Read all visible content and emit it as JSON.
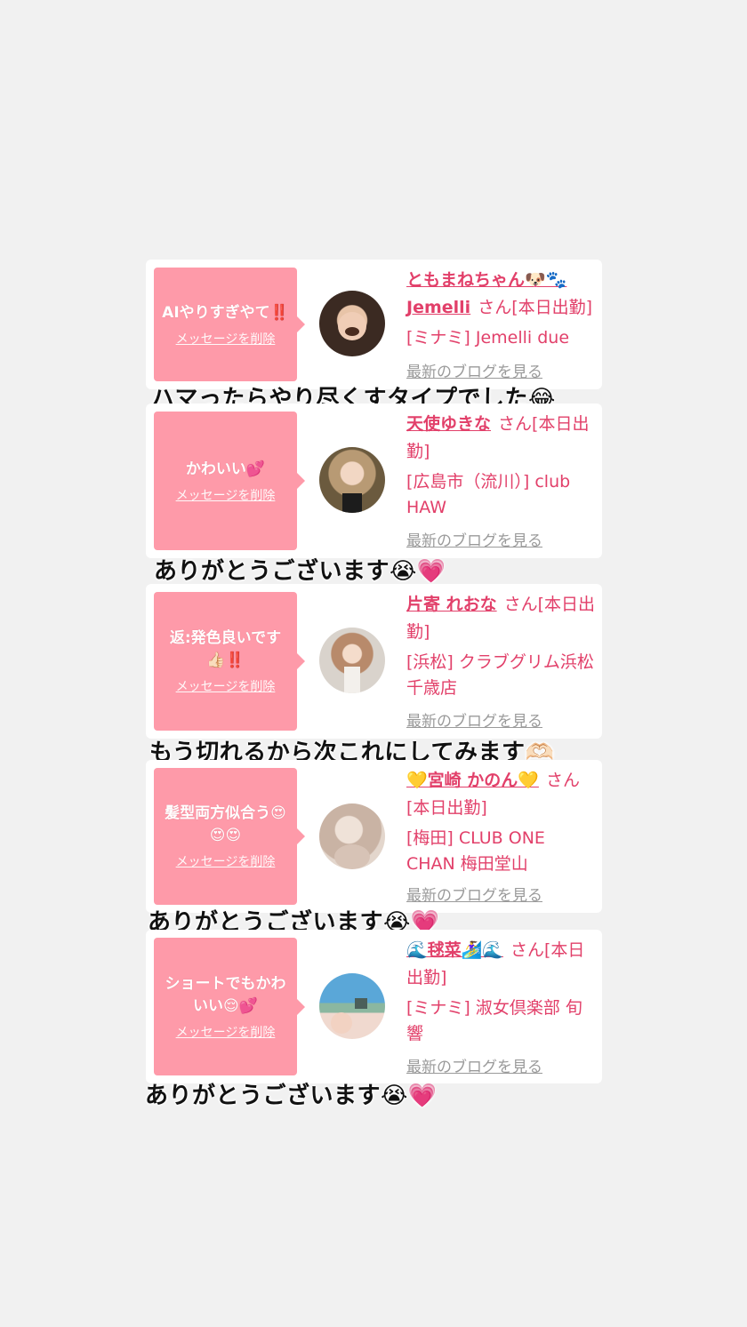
{
  "common": {
    "delete_label": "メッセージを削除",
    "blog_label": "最新のブログを見る",
    "san": "さん"
  },
  "entries": [
    {
      "message": "AIやりすぎやて‼️",
      "name": "ともまねちゃん🐶🐾",
      "name2": "Jemelli",
      "status": "[本日出勤]",
      "shop": "[ミナミ] Jemelli due",
      "caption": "ハマったらやり尽くすタイプでした😂",
      "avatar_colors": [
        "#3b2a22",
        "#e8c4a8"
      ]
    },
    {
      "message": "かわいい💕",
      "name": "天使ゆきな",
      "status": "[本日出勤]",
      "shop": "[広島市（流川）] club HAW",
      "caption": "ありがとうございます😭💗",
      "avatar_colors": [
        "#6b5a3e",
        "#f2d7c4"
      ]
    },
    {
      "message": "返:発色良いです👍🏻‼️",
      "name": "片寄 れおな",
      "status": "[本日出勤]",
      "shop": "[浜松] クラブグリム浜松千歳店",
      "caption": "もう切れるから次これにしてみます🫶🏻",
      "avatar_colors": [
        "#d9d3cc",
        "#b88a6b"
      ]
    },
    {
      "message": "髪型両方似合う😍😍😍",
      "name": "💛宮崎 かのん💛",
      "status": "[本日出勤]",
      "shop": "[梅田] CLUB ONE CHAN 梅田堂山",
      "caption": "ありがとうございます😭💗",
      "avatar_colors": [
        "#e3d6cc",
        "#c9b3a4"
      ]
    },
    {
      "message": "ショートでもかわいい😌💕",
      "name": "🌊毬菜🏄‍♀️🌊",
      "status": "[本日出勤]",
      "shop": "[ミナミ] 淑女倶楽部 旬響",
      "caption": "ありがとうございます😭💗",
      "avatar_colors": [
        "#5aa7d8",
        "#f0d9cf"
      ]
    }
  ]
}
